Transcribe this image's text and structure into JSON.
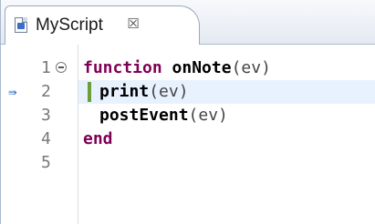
{
  "tab": {
    "title": "MyScript",
    "close_glyph": "☒",
    "icon": "script-file-icon"
  },
  "editor": {
    "lines": [
      {
        "number": "1",
        "folded": true,
        "parts": [
          {
            "t": "function ",
            "k": "kw"
          },
          {
            "t": "onNote",
            "k": "fn"
          },
          {
            "t": "(ev)",
            "k": "arg"
          }
        ]
      },
      {
        "number": "2",
        "debug": true,
        "parts": [
          {
            "t": "print",
            "k": "fn"
          },
          {
            "t": "(ev)",
            "k": "arg"
          }
        ]
      },
      {
        "number": "3",
        "parts": [
          {
            "t": "postEvent",
            "k": "fn"
          },
          {
            "t": "(ev)",
            "k": "arg"
          }
        ]
      },
      {
        "number": "4",
        "parts": [
          {
            "t": "end",
            "k": "kw"
          }
        ]
      },
      {
        "number": "5",
        "parts": []
      }
    ],
    "debug_arrow_glyph": "⇛"
  },
  "colors": {
    "keyword": "#7f0055",
    "current_line": "#e8f2fe",
    "debug_marker": "#6c9f3a"
  }
}
